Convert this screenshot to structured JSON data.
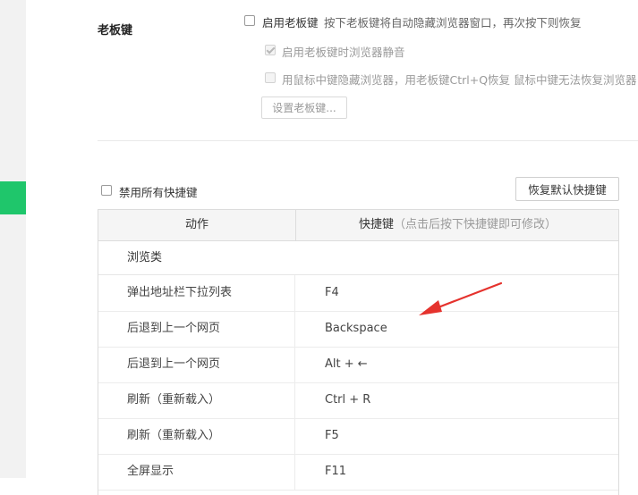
{
  "boss_key": {
    "title": "老板键",
    "enable": {
      "label": "启用老板键",
      "description": "按下老板键将自动隐藏浏览器窗口，再次按下则恢复",
      "checked": false
    },
    "mute": {
      "label": "启用老板键时浏览器静音",
      "checked": true,
      "disabled": true
    },
    "middle_click": {
      "label": "用鼠标中键隐藏浏览器，用老板键Ctrl+Q恢复  鼠标中键无法恢复浏览器",
      "checked": false,
      "disabled": true
    },
    "setup_button": "设置老板键..."
  },
  "shortcuts": {
    "disable_all_label": "禁用所有快捷键",
    "restore_button": "恢复默认快捷键",
    "table": {
      "col_action": "动作",
      "col_shortcut": "快捷键",
      "col_shortcut_hint": "（点击后按下快捷键即可修改）",
      "group": "浏览类",
      "rows": [
        {
          "action": "弹出地址栏下拉列表",
          "key": "F4"
        },
        {
          "action": "后退到上一个网页",
          "key": "Backspace"
        },
        {
          "action": "后退到上一个网页",
          "key": "Alt + ←"
        },
        {
          "action": "刷新（重新载入）",
          "key": "Ctrl + R"
        },
        {
          "action": "刷新（重新载入）",
          "key": "F5"
        },
        {
          "action": "全屏显示",
          "key": "F11"
        }
      ]
    }
  },
  "colors": {
    "accent": "#1fc66b",
    "annotation_arrow": "#e5322d"
  }
}
